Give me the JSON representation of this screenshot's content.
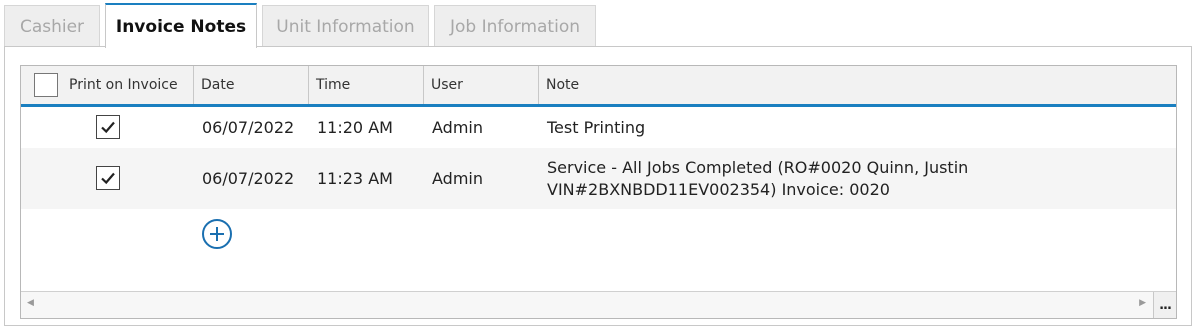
{
  "tabs": [
    {
      "label": "Cashier",
      "state": "disabled"
    },
    {
      "label": "Invoice Notes",
      "state": "active"
    },
    {
      "label": "Unit Information",
      "state": "disabled"
    },
    {
      "label": "Job Information",
      "state": "disabled"
    }
  ],
  "grid": {
    "columns": [
      "Print on Invoice",
      "Date",
      "Time",
      "User",
      "Note"
    ],
    "header_checkbox_checked": false,
    "rows": [
      {
        "print": true,
        "date": "06/07/2022",
        "time": "11:20 AM",
        "user": "Admin",
        "note_line1": "Test Printing",
        "note_line2": ""
      },
      {
        "print": true,
        "date": "06/07/2022",
        "time": "11:23 AM",
        "user": "Admin",
        "note_line1": "Service - All Jobs Completed (RO#0020 Quinn, Justin",
        "note_line2": "VIN#2BXNBDD11EV002354) Invoice: 0020"
      }
    ],
    "add_icon": "plus-circle-icon",
    "more_label": "..."
  },
  "colors": {
    "accent": "#1a7fc0",
    "row_alt": "#f5f5f5",
    "tab_inactive_text": "#a8a8a8"
  }
}
